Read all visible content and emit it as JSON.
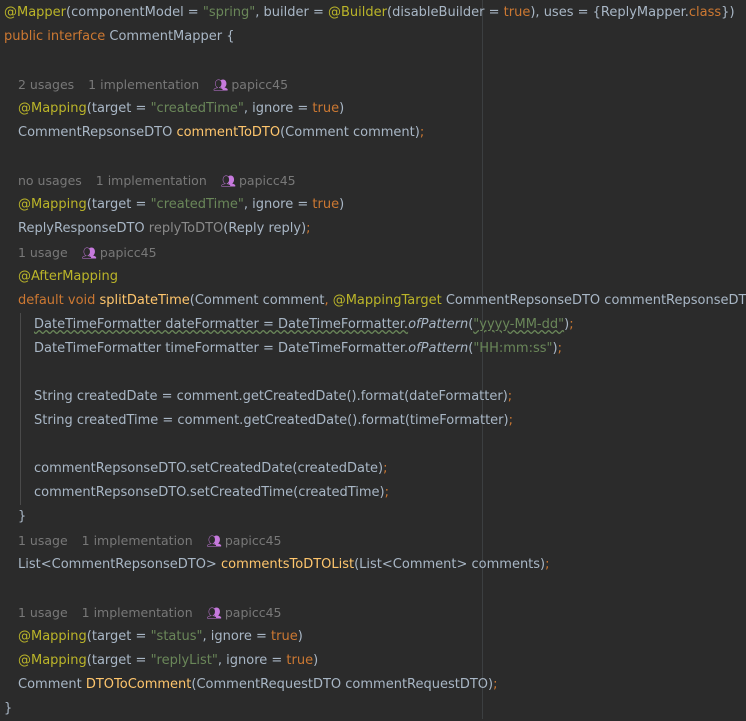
{
  "hints": {
    "h1": {
      "usages": "2 usages",
      "impl": "1 implementation",
      "author": "papicc45"
    },
    "h2": {
      "usages": "no usages",
      "impl": "1 implementation",
      "author": "papicc45"
    },
    "h3": {
      "usages": "1 usage",
      "author": "papicc45"
    },
    "h4": {
      "usages": "1 usage",
      "impl": "1 implementation",
      "author": "papicc45"
    },
    "h5": {
      "usages": "1 usage",
      "impl": "1 implementation",
      "author": "papicc45"
    }
  },
  "code": {
    "l1a": "@Mapper",
    "l1b": "(componentModel = ",
    "l1c": "\"spring\"",
    "l1d": ", builder = ",
    "l1e": "@Builder",
    "l1f": "(disableBuilder = ",
    "l1g": "true",
    "l1h": "), uses = {ReplyMapper.",
    "l1i": "class",
    "l1j": "})",
    "l2a": "public interface",
    "l2b": " CommentMapper {",
    "m1a": "@Mapping",
    "m1b": "(target = ",
    "m1c": "\"createdTime\"",
    "m1d": ", ignore = ",
    "m1e": "true",
    "m1f": ")",
    "d1a": "CommentRepsonseDTO ",
    "d1b": "commentToDTO",
    "d1c": "(Comment comment)",
    "d1d": ";",
    "m2a": "@Mapping",
    "m2b": "(target = ",
    "m2c": "\"createdTime\"",
    "m2d": ", ignore = ",
    "m2e": "true",
    "m2f": ")",
    "d2a": "ReplyResponseDTO ",
    "d2b": "replyToDTO",
    "d2c": "(Reply reply)",
    "d2d": ";",
    "am": "@AfterMapping",
    "s1a": "default void",
    "s1b": " ",
    "s1c": "splitDateTime",
    "s1d": "(Comment comment",
    "s1e": ", ",
    "s1f": "@MappingTarget",
    "s1g": " CommentRepsonseDTO commentRepsonseDTO) {",
    "b1a": "DateTimeFormatter dateFormatter = DateTimeFormatter.",
    "b1b": "ofPattern",
    "b1c": "(",
    "b1d": "\"yyyy-MM-dd\"",
    "b1e": ")",
    "b1f": ";",
    "b2a": "DateTimeFormatter timeFormatter = DateTimeFormatter.",
    "b2b": "ofPattern",
    "b2c": "(",
    "b2d": "\"HH:mm:ss\"",
    "b2e": ")",
    "b2f": ";",
    "b3a": "String createdDate = comment.getCreatedDate().format(dateFormatter)",
    "b3b": ";",
    "b4a": "String createdTime = comment.getCreatedDate().format(timeFormatter)",
    "b4b": ";",
    "b5a": "commentRepsonseDTO.setCreatedDate(createdDate)",
    "b5b": ";",
    "b6a": "commentRepsonseDTO.setCreatedTime(createdTime)",
    "b6b": ";",
    "close1": "}",
    "l3a": "List<CommentRepsonseDTO> ",
    "l3b": "commentsToDTOList",
    "l3c": "(List<Comment> comments)",
    "l3d": ";",
    "m3a": "@Mapping",
    "m3b": "(target = ",
    "m3c": "\"status\"",
    "m3d": ", ignore = ",
    "m3e": "true",
    "m3f": ")",
    "m4a": "@Mapping",
    "m4b": "(target = ",
    "m4c": "\"replyList\"",
    "m4d": ", ignore = ",
    "m4e": "true",
    "m4f": ")",
    "d3a": "Comment ",
    "d3b": "DTOToComment",
    "d3c": "(CommentRequestDTO commentRequestDTO)",
    "d3d": ";",
    "close2": "}"
  },
  "colors": {
    "background": "#2b2b2b",
    "text": "#a9b7c6",
    "keyword": "#cc7832",
    "string": "#6a8759",
    "annotation": "#bbb529",
    "method": "#ffc66d",
    "hint": "#787878"
  }
}
